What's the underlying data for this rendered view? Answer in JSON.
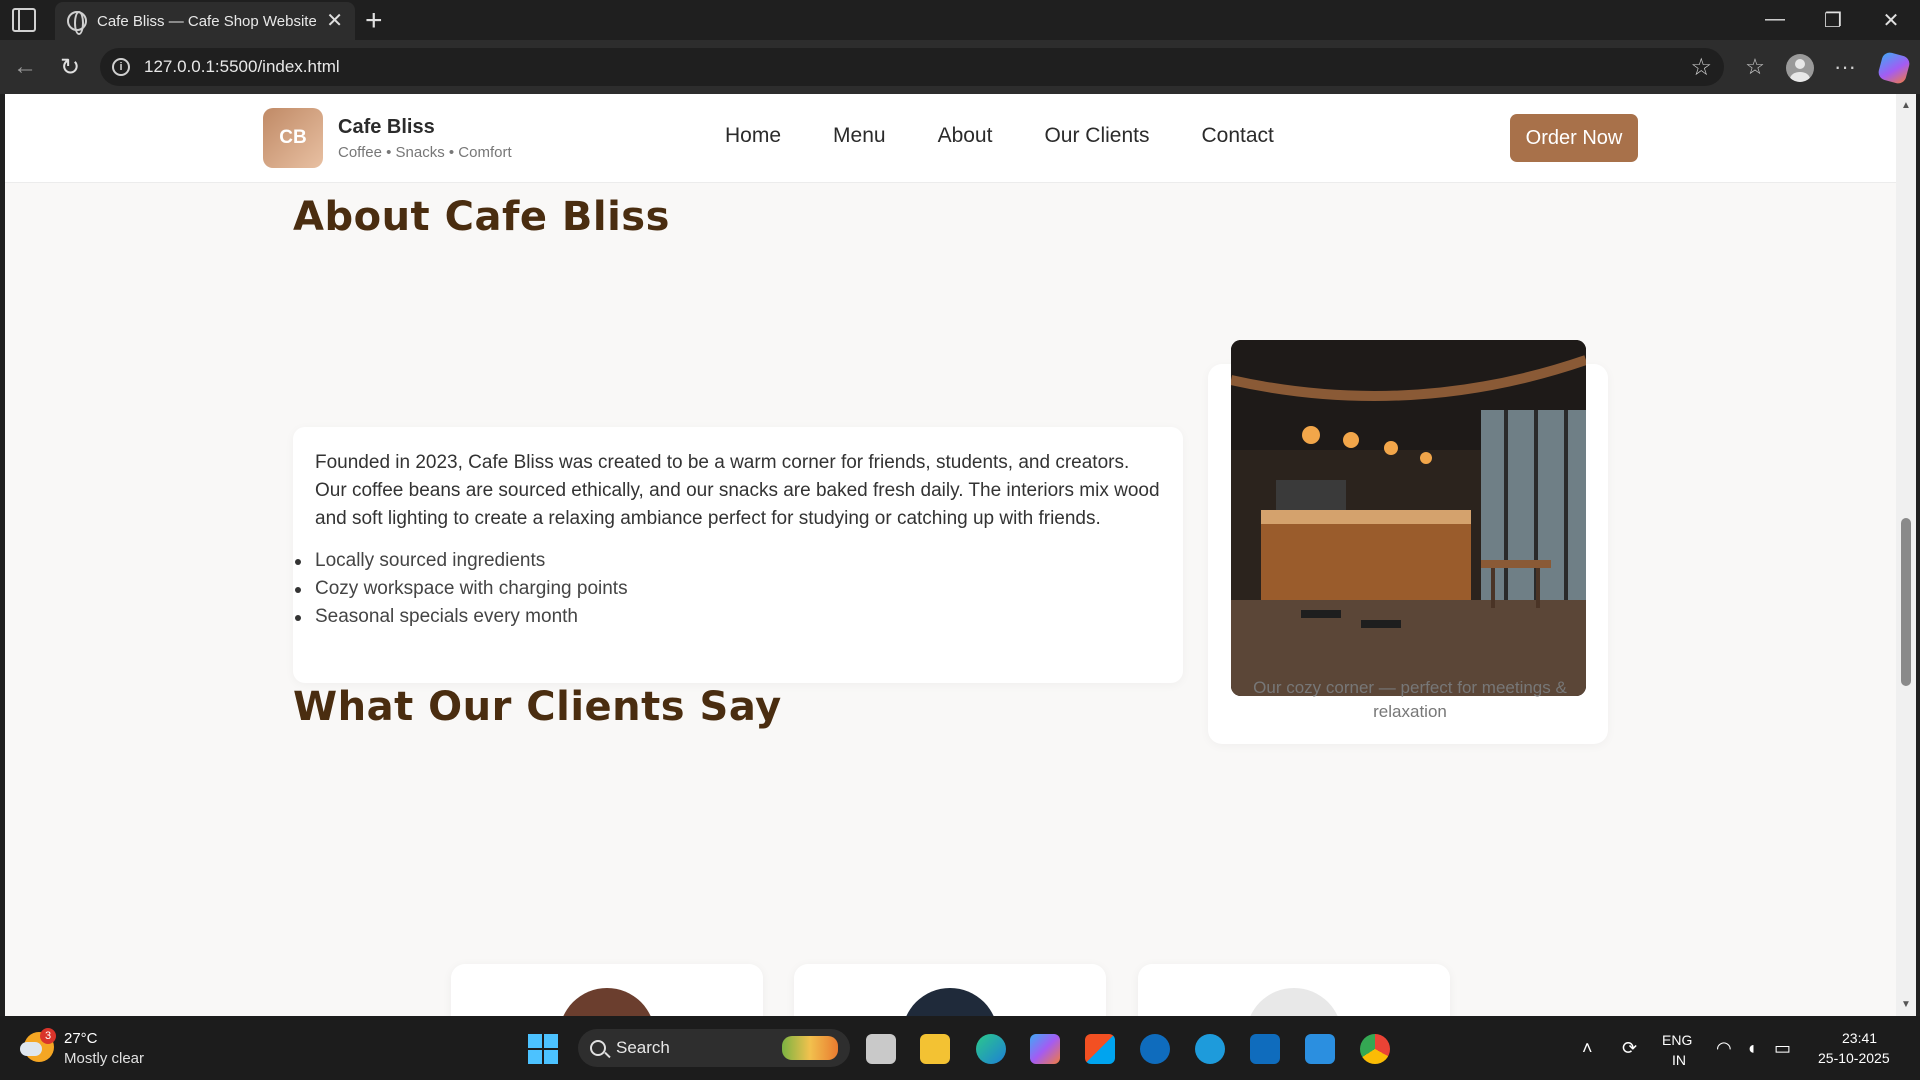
{
  "browser": {
    "tab_title": "Cafe Bliss — Cafe Shop Website",
    "url": "127.0.0.1:5500/index.html"
  },
  "site": {
    "logo_initials": "CB",
    "brand_name": "Cafe Bliss",
    "tagline": "Coffee • Snacks • Comfort",
    "nav": [
      "Home",
      "Menu",
      "About",
      "Our Clients",
      "Contact"
    ],
    "order_button": "Order Now"
  },
  "about": {
    "title": "About Cafe Bliss",
    "paragraph": "Founded in 2023, Cafe Bliss was created to be a warm corner for friends, students, and creators. Our coffee beans are sourced ethically, and our snacks are baked fresh daily. The interiors mix wood and soft lighting to create a relaxing ambiance perfect for studying or catching up with friends.",
    "features": [
      "Locally sourced ingredients",
      "Cozy workspace with charging points",
      "Seasonal specials every month"
    ],
    "image_caption": "Our cozy corner — perfect for meetings & relaxation"
  },
  "clients": {
    "title": "What Our Clients Say"
  },
  "taskbar": {
    "weather_badge": "3",
    "temperature": "27°C",
    "weather": "Mostly clear",
    "search": "Search",
    "lang_1": "ENG",
    "lang_2": "IN",
    "time": "23:41",
    "date": "25-10-2025"
  },
  "colors": {
    "accent": "#a8714a",
    "heading": "#4a2d10",
    "page_bg": "#f9f8f7"
  }
}
